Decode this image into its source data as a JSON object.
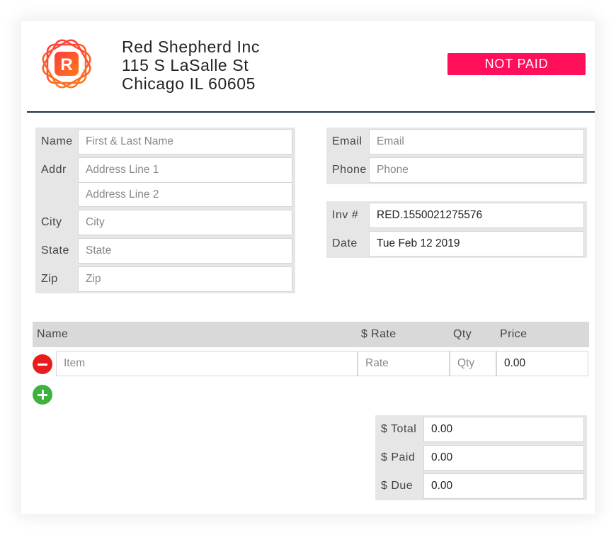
{
  "company": {
    "name": "Red Shepherd Inc",
    "address_line": "115 S LaSalle St",
    "city_line": "Chicago IL 60605",
    "logo_letter": "R"
  },
  "status": "NOT PAID",
  "colors": {
    "accent": "#ff0f5a",
    "divider": "#1f2d4a",
    "remove": "#e81c1c",
    "add": "#3db33d"
  },
  "client": {
    "name": {
      "label": "Name",
      "placeholder": "First & Last Name"
    },
    "addr": {
      "label": "Addr",
      "placeholder1": "Address Line 1",
      "placeholder2": "Address Line 2"
    },
    "city": {
      "label": "City",
      "placeholder": "City"
    },
    "state": {
      "label": "State",
      "placeholder": "State"
    },
    "zip": {
      "label": "Zip",
      "placeholder": "Zip"
    }
  },
  "contact": {
    "email": {
      "label": "Email",
      "placeholder": "Email"
    },
    "phone": {
      "label": "Phone",
      "placeholder": "Phone"
    }
  },
  "invoice": {
    "number": {
      "label": "Inv #",
      "value": "RED.1550021275576"
    },
    "date": {
      "label": "Date",
      "value": "Tue Feb 12 2019"
    }
  },
  "items": {
    "headers": {
      "name": "Name",
      "rate": "$ Rate",
      "qty": "Qty",
      "price": "Price"
    },
    "row": {
      "item_placeholder": "Item",
      "rate_placeholder": "Rate",
      "qty_placeholder": "Qty",
      "price": "0.00"
    }
  },
  "totals": {
    "total": {
      "label": "$ Total",
      "value": "0.00"
    },
    "paid": {
      "label": "$ Paid",
      "value": "0.00"
    },
    "due": {
      "label": "$ Due",
      "value": "0.00"
    }
  },
  "icons": {
    "logo": "red-shepherd-logo",
    "remove": "minus-circle-icon",
    "add": "plus-circle-icon"
  }
}
